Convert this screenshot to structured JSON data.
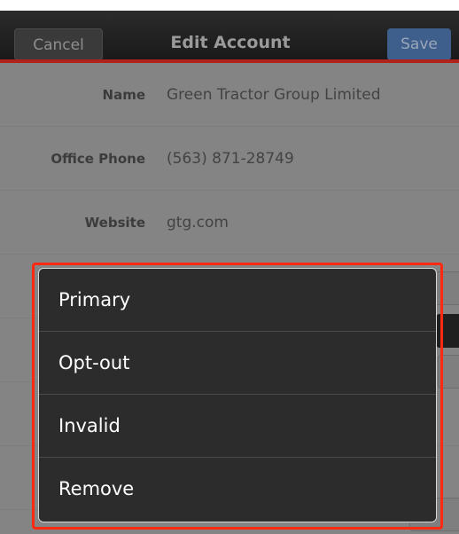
{
  "header": {
    "cancel_label": "Cancel",
    "title": "Edit Account",
    "save_label": "Save"
  },
  "fields": [
    {
      "label": "Name",
      "value": "Green Tractor Group Limited"
    },
    {
      "label": "Office Phone",
      "value": "(563) 871-28749"
    },
    {
      "label": "Website",
      "value": "gtg.com"
    }
  ],
  "popup_menu": {
    "items": [
      {
        "label": "Primary"
      },
      {
        "label": "Opt-out"
      },
      {
        "label": "Invalid"
      },
      {
        "label": "Remove"
      }
    ]
  },
  "colors": {
    "highlight_border": "#ff2a10",
    "nav_accent_red": "#b0231a",
    "save_button": "#3e5f8c"
  }
}
